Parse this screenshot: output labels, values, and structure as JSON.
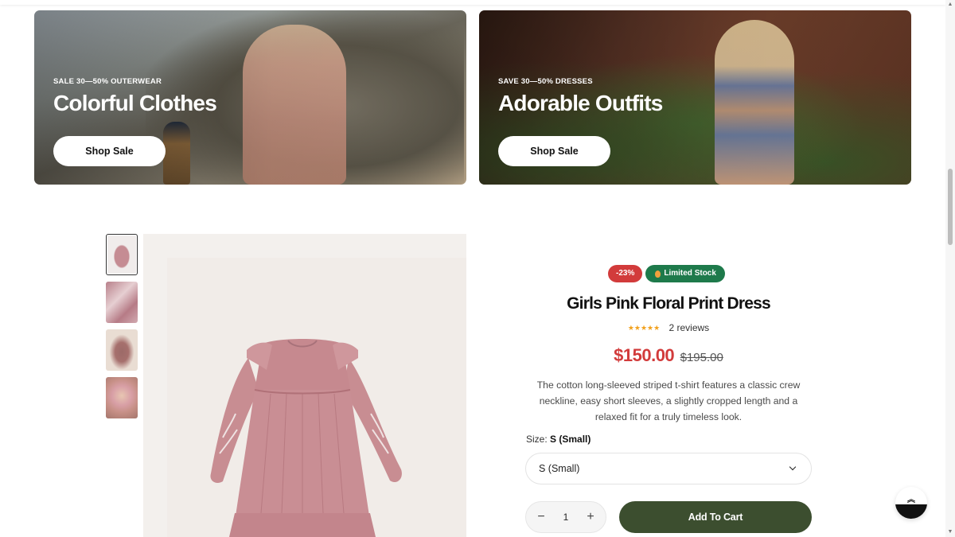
{
  "banners": [
    {
      "eyebrow": "SALE 30—50% OUTERWEAR",
      "title": "Colorful Clothes",
      "button": "Shop Sale"
    },
    {
      "eyebrow": "SAVE 30—50% DRESSES",
      "title": "Adorable Outfits",
      "button": "Shop Sale"
    }
  ],
  "product": {
    "badges": {
      "discount": "-23%",
      "stock": "Limited Stock"
    },
    "title": "Girls Pink Floral Print Dress",
    "rating": {
      "stars": "★★★★★",
      "reviews": "2 reviews"
    },
    "price": {
      "current": "$150.00",
      "original": "$195.00"
    },
    "description": "The cotton long-sleeved striped t-shirt features a classic crew neckline, easy short sleeves, a slightly cropped length and a relaxed fit for a truly timeless look.",
    "size": {
      "label": "Size:",
      "selected": "S (Small)",
      "select_value": "S (Small)"
    },
    "quantity": {
      "value": "1",
      "minus": "−",
      "plus": "+"
    },
    "add_to_cart": "Add To Cart"
  },
  "scroll_top": {
    "icon": "double-chevron-up-icon",
    "glyph": "︽"
  },
  "colors": {
    "discount_badge": "#d23b3b",
    "stock_badge": "#1e7a4b",
    "price": "#d23b3b",
    "add_to_cart": "#3c4e2f",
    "stars": "#f2a11d"
  }
}
